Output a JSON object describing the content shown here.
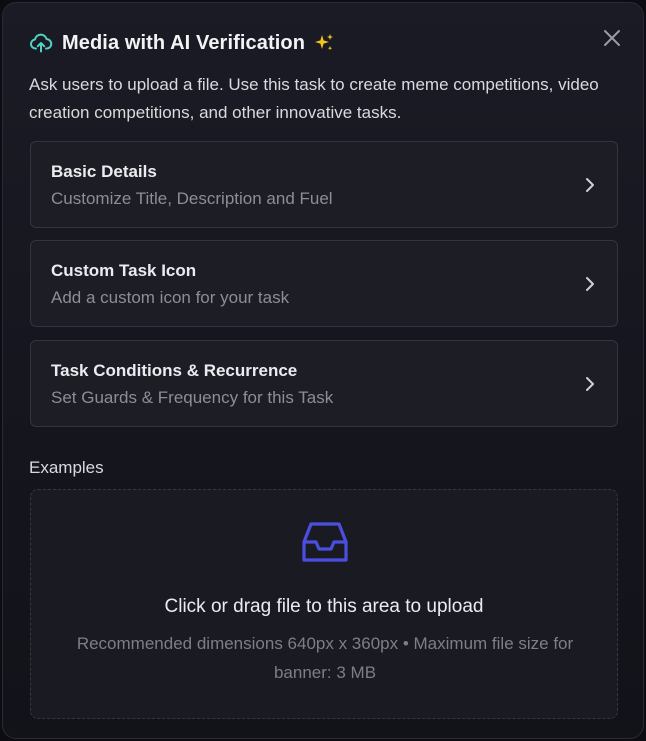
{
  "modal": {
    "title": "Media with AI Verification",
    "sparkle": "✨",
    "description": "Ask users to upload a file. Use this task to create meme competitions, video creation competitions, and other innovative tasks.",
    "icons": {
      "header": "cloud-upload-icon",
      "close": "close-icon",
      "card_arrow": "chevron-right-icon",
      "upload": "inbox-icon"
    },
    "colors": {
      "accent_teal": "#4fd1c5",
      "accent_blue": "#4a4fe0"
    }
  },
  "cards": [
    {
      "title": "Basic Details",
      "subtitle": "Customize Title, Description and Fuel"
    },
    {
      "title": "Custom Task Icon",
      "subtitle": "Add a custom icon for your task"
    },
    {
      "title": "Task Conditions & Recurrence",
      "subtitle": "Set Guards & Frequency for this Task"
    }
  ],
  "examples": {
    "label": "Examples",
    "upload_text": "Click or drag file to this area to upload",
    "upload_hint": "Recommended dimensions 640px x 360px • Maximum file size for banner: 3 MB"
  }
}
